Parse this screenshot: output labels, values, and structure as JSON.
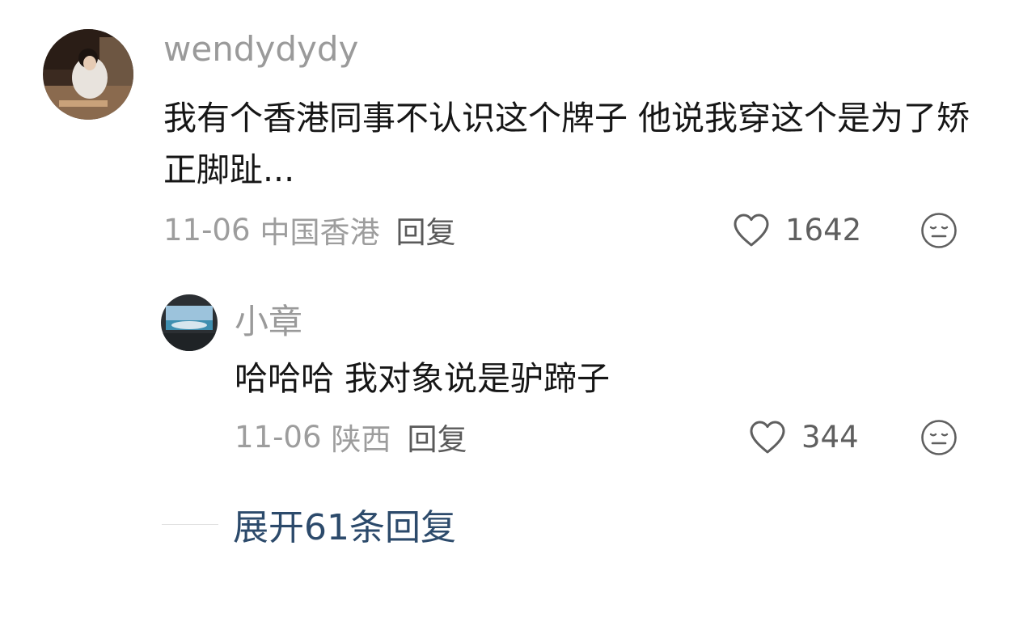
{
  "comments": [
    {
      "username": "wendydydy",
      "content": "我有个香港同事不认识这个牌子 他说我穿这个是为了矫正脚趾...",
      "date": "11-06",
      "location": "中国香港",
      "reply_label": "回复",
      "like_count": "1642",
      "avatar_icon": "user-photo-avatar",
      "like_icon": "heart-outline-icon",
      "dislike_icon": "meh-face-icon"
    },
    {
      "username": "小章",
      "content": "哈哈哈 我对象说是驴蹄子",
      "date": "11-06",
      "location": "陕西",
      "reply_label": "回复",
      "like_count": "344",
      "avatar_icon": "landscape-photo-avatar",
      "like_icon": "heart-outline-icon",
      "dislike_icon": "meh-face-icon"
    }
  ],
  "expand_replies_label": "展开61条回复",
  "colors": {
    "username": "#9a9a9a",
    "content": "#161616",
    "meta": "#9d9d9d",
    "reply": "#5a5a5a",
    "expand_link": "#2c4a6b"
  }
}
